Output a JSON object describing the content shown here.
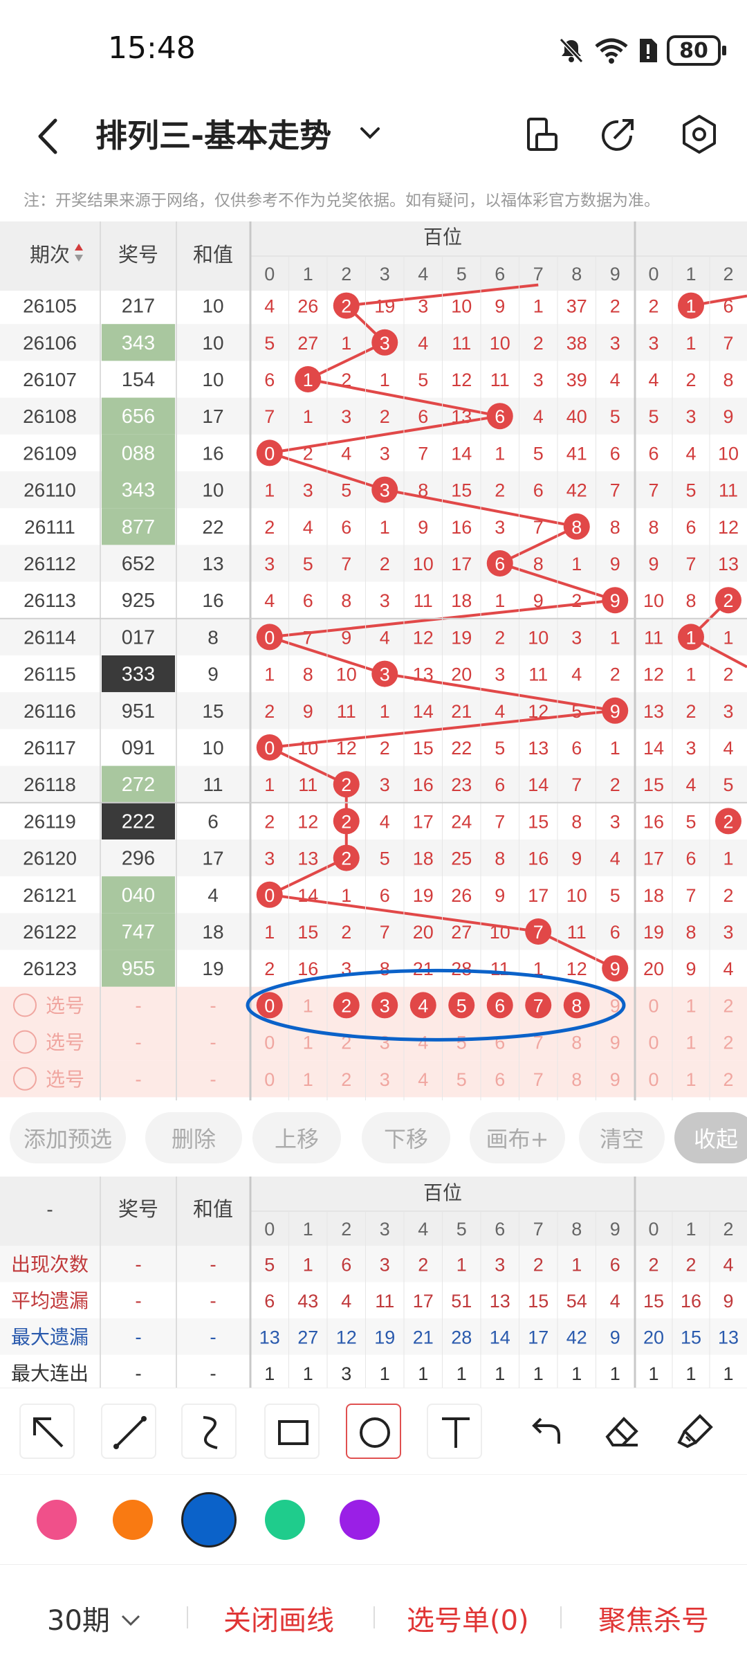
{
  "status_bar": {
    "time": "15:48",
    "battery": "80"
  },
  "header": {
    "title": "排列三-基本走势"
  },
  "notice": "注：开奖结果来源于网络，仅供参考不作为兑奖依据。如有疑问，以福体彩官方数据为准。",
  "table": {
    "col_labels": {
      "period": "期次",
      "number": "奖号",
      "sum": "和值",
      "hundreds": "百位"
    },
    "digits": [
      "0",
      "1",
      "2",
      "3",
      "4",
      "5",
      "6",
      "7",
      "8",
      "9"
    ],
    "rows": [
      {
        "period": "26105",
        "number": "217",
        "sum": "10",
        "style": "plain",
        "h": [
          "4",
          "26",
          "2",
          "19",
          "3",
          "10",
          "9",
          "1",
          "37",
          "2"
        ],
        "n": [
          "2",
          "1",
          "6"
        ]
      },
      {
        "period": "26106",
        "number": "343",
        "sum": "10",
        "style": "green",
        "h": [
          "5",
          "27",
          "1",
          "3",
          "4",
          "11",
          "10",
          "2",
          "38",
          "3"
        ],
        "n": [
          "3",
          "1",
          "7"
        ]
      },
      {
        "period": "26107",
        "number": "154",
        "sum": "10",
        "style": "plain",
        "h": [
          "6",
          "1",
          "2",
          "1",
          "5",
          "12",
          "11",
          "3",
          "39",
          "4"
        ],
        "n": [
          "4",
          "2",
          "8"
        ]
      },
      {
        "period": "26108",
        "number": "656",
        "sum": "17",
        "style": "green",
        "h": [
          "7",
          "1",
          "3",
          "2",
          "6",
          "13",
          "6",
          "4",
          "40",
          "5"
        ],
        "n": [
          "5",
          "3",
          "9"
        ]
      },
      {
        "period": "26109",
        "number": "088",
        "sum": "16",
        "style": "green",
        "h": [
          "0",
          "2",
          "4",
          "3",
          "7",
          "14",
          "1",
          "5",
          "41",
          "6"
        ],
        "n": [
          "6",
          "4",
          "10"
        ]
      },
      {
        "period": "26110",
        "number": "343",
        "sum": "10",
        "style": "green",
        "h": [
          "1",
          "3",
          "5",
          "3",
          "8",
          "15",
          "2",
          "6",
          "42",
          "7"
        ],
        "n": [
          "7",
          "5",
          "11"
        ]
      },
      {
        "period": "26111",
        "number": "877",
        "sum": "22",
        "style": "green",
        "h": [
          "2",
          "4",
          "6",
          "1",
          "9",
          "16",
          "3",
          "7",
          "8",
          "8"
        ],
        "n": [
          "8",
          "6",
          "12"
        ]
      },
      {
        "period": "26112",
        "number": "652",
        "sum": "13",
        "style": "plain",
        "h": [
          "3",
          "5",
          "7",
          "2",
          "10",
          "17",
          "6",
          "8",
          "1",
          "9"
        ],
        "n": [
          "9",
          "7",
          "13"
        ]
      },
      {
        "period": "26113",
        "number": "925",
        "sum": "16",
        "style": "plain",
        "h": [
          "4",
          "6",
          "8",
          "3",
          "11",
          "18",
          "1",
          "9",
          "2",
          "9"
        ],
        "n": [
          "10",
          "8",
          "2"
        ]
      },
      {
        "period": "26114",
        "number": "017",
        "sum": "8",
        "style": "plain",
        "h": [
          "0",
          "7",
          "9",
          "4",
          "12",
          "19",
          "2",
          "10",
          "3",
          "1"
        ],
        "n": [
          "11",
          "1",
          "1"
        ]
      },
      {
        "period": "26115",
        "number": "333",
        "sum": "9",
        "style": "dark",
        "h": [
          "1",
          "8",
          "10",
          "3",
          "13",
          "20",
          "3",
          "11",
          "4",
          "2"
        ],
        "n": [
          "12",
          "1",
          "2"
        ]
      },
      {
        "period": "26116",
        "number": "951",
        "sum": "15",
        "style": "plain",
        "h": [
          "2",
          "9",
          "11",
          "1",
          "14",
          "21",
          "4",
          "12",
          "5",
          "9"
        ],
        "n": [
          "13",
          "2",
          "3"
        ]
      },
      {
        "period": "26117",
        "number": "091",
        "sum": "10",
        "style": "plain",
        "h": [
          "0",
          "10",
          "12",
          "2",
          "15",
          "22",
          "5",
          "13",
          "6",
          "1"
        ],
        "n": [
          "14",
          "3",
          "4"
        ]
      },
      {
        "period": "26118",
        "number": "272",
        "sum": "11",
        "style": "green",
        "h": [
          "1",
          "11",
          "2",
          "3",
          "16",
          "23",
          "6",
          "14",
          "7",
          "2"
        ],
        "n": [
          "15",
          "4",
          "5"
        ]
      },
      {
        "period": "26119",
        "number": "222",
        "sum": "6",
        "style": "dark",
        "h": [
          "2",
          "12",
          "2",
          "4",
          "17",
          "24",
          "7",
          "15",
          "8",
          "3"
        ],
        "n": [
          "16",
          "5",
          "2"
        ]
      },
      {
        "period": "26120",
        "number": "296",
        "sum": "17",
        "style": "plain",
        "h": [
          "3",
          "13",
          "2",
          "5",
          "18",
          "25",
          "8",
          "16",
          "9",
          "4"
        ],
        "n": [
          "17",
          "6",
          "1"
        ]
      },
      {
        "period": "26121",
        "number": "040",
        "sum": "4",
        "style": "green",
        "h": [
          "0",
          "14",
          "1",
          "6",
          "19",
          "26",
          "9",
          "17",
          "10",
          "5"
        ],
        "n": [
          "18",
          "7",
          "2"
        ]
      },
      {
        "period": "26122",
        "number": "747",
        "sum": "18",
        "style": "green",
        "h": [
          "1",
          "15",
          "2",
          "7",
          "20",
          "27",
          "10",
          "7",
          "11",
          "6"
        ],
        "n": [
          "19",
          "8",
          "3"
        ]
      },
      {
        "period": "26123",
        "number": "955",
        "sum": "19",
        "style": "green",
        "h": [
          "2",
          "16",
          "3",
          "8",
          "21",
          "28",
          "11",
          "1",
          "12",
          "9"
        ],
        "n": [
          "20",
          "9",
          "4"
        ]
      }
    ],
    "hits": [
      2,
      3,
      1,
      6,
      0,
      3,
      8,
      6,
      9,
      0,
      3,
      9,
      0,
      2,
      2,
      2,
      0,
      7,
      9
    ],
    "n_hits": [
      1,
      null,
      null,
      null,
      null,
      null,
      null,
      null,
      2,
      1,
      null,
      null,
      null,
      null,
      2,
      null,
      null,
      null,
      null
    ],
    "pick_label": "选号",
    "dash": "-",
    "pick_selected": [
      0,
      2,
      3,
      4,
      5,
      6,
      7,
      8
    ]
  },
  "actions": [
    "添加预选",
    "删除",
    "上移",
    "下移",
    "画布+",
    "清空",
    "收起"
  ],
  "stats": {
    "header_dash": "-",
    "rows": [
      {
        "label": "出现次数",
        "color": "#c0393b",
        "h": [
          "5",
          "1",
          "6",
          "3",
          "2",
          "1",
          "3",
          "2",
          "1",
          "6"
        ],
        "n": [
          "2",
          "2",
          "4"
        ]
      },
      {
        "label": "平均遗漏",
        "color": "#c0393b",
        "h": [
          "6",
          "43",
          "4",
          "11",
          "17",
          "51",
          "13",
          "15",
          "54",
          "4"
        ],
        "n": [
          "15",
          "16",
          "9"
        ]
      },
      {
        "label": "最大遗漏",
        "color": "#2a5aad",
        "h": [
          "13",
          "27",
          "12",
          "19",
          "21",
          "28",
          "14",
          "17",
          "42",
          "9"
        ],
        "n": [
          "20",
          "15",
          "13"
        ]
      },
      {
        "label": "最大连出",
        "color": "#333333",
        "h": [
          "1",
          "1",
          "3",
          "1",
          "1",
          "1",
          "1",
          "1",
          "1",
          "1"
        ],
        "n": [
          "1",
          "1",
          "1"
        ]
      }
    ]
  },
  "draw_tools": [
    "arrow-tool-icon",
    "line-tool-icon",
    "curve-tool-icon",
    "rectangle-tool-icon",
    "circle-tool-icon",
    "text-tool-icon",
    "undo-icon",
    "eraser-icon",
    "clear-brush-icon"
  ],
  "draw_colors": [
    "#f0508a",
    "#f97a12",
    "#0b62c9",
    "#1fcc8c",
    "#9a1fe6"
  ],
  "selected_color": "#0b62c9",
  "bottom": {
    "period": "30期",
    "close": "关闭画线",
    "ticket": "选号单(0)",
    "focus": "聚焦杀号"
  }
}
